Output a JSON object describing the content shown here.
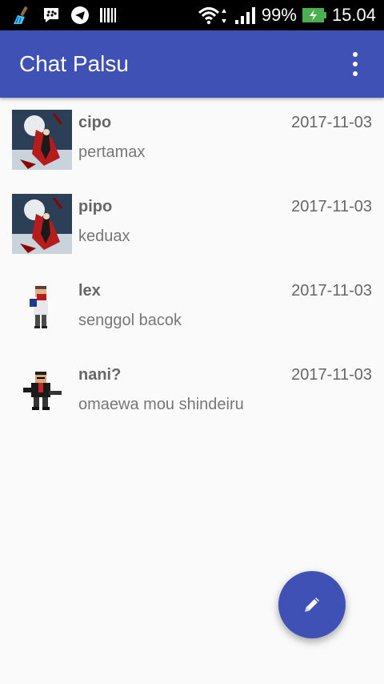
{
  "status_bar": {
    "battery": "99%",
    "time": "15.04",
    "left_icons": [
      "broom-icon",
      "bbm-icon",
      "telegram-icon",
      "barcode-icon"
    ],
    "right_icons": [
      "wifi-icon",
      "signal-icon",
      "battery-charging-icon"
    ]
  },
  "app_bar": {
    "title": "Chat Palsu",
    "menu_icon": "more-vert-icon",
    "color": "#3f51b5"
  },
  "chats": [
    {
      "name": "cipo",
      "message": "pertamax",
      "date": "2017-11-03",
      "avatar": "anime-girl-avatar"
    },
    {
      "name": "pipo",
      "message": "keduax",
      "date": "2017-11-03",
      "avatar": "anime-girl-avatar"
    },
    {
      "name": "lex",
      "message": "senggol bacok",
      "date": "2017-11-03",
      "avatar": "pixel-bandit-avatar"
    },
    {
      "name": "nani?",
      "message": "omaewa mou shindeiru",
      "date": "2017-11-03",
      "avatar": "pixel-gunman-avatar"
    }
  ],
  "fab": {
    "icon": "pencil-icon",
    "color": "#3f51b5"
  }
}
